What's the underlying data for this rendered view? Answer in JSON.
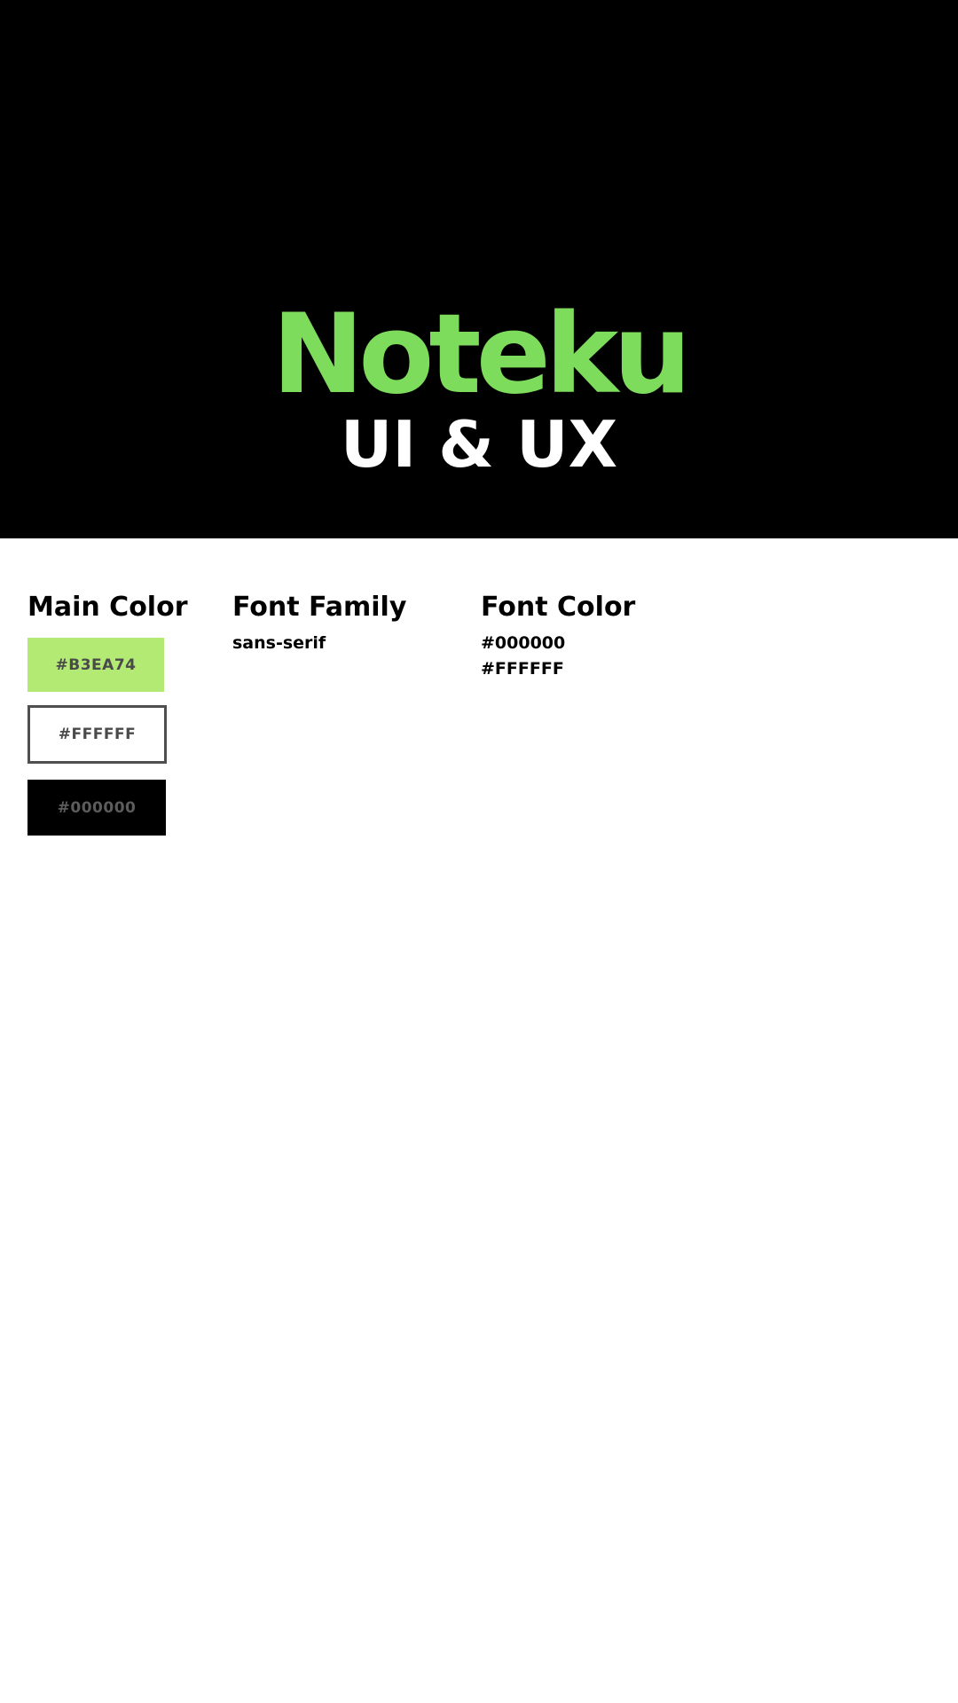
{
  "hero": {
    "title": "Noteku",
    "subtitle": "UI & UX",
    "title_color": "#7EDC5C",
    "background_color": "#000000"
  },
  "main_color": {
    "heading": "Main Color",
    "swatches": [
      {
        "label": "#B3EA74",
        "fill": "#B3EA74"
      },
      {
        "label": "#FFFFFF",
        "fill": "#FFFFFF"
      },
      {
        "label": "#000000",
        "fill": "#000000"
      }
    ]
  },
  "font_family": {
    "heading": "Font Family",
    "value": "sans-serif"
  },
  "font_color": {
    "heading": "Font Color",
    "values": [
      "#000000",
      "#FFFFFF"
    ]
  }
}
